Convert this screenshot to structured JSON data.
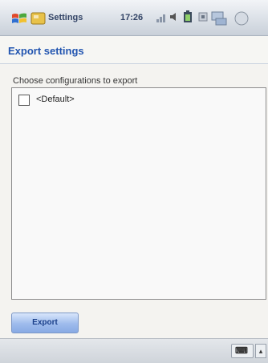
{
  "titlebar": {
    "app_title": "Settings",
    "time": "17:26"
  },
  "page": {
    "heading": "Export settings",
    "section_label": "Choose configurations to export"
  },
  "list": {
    "items": [
      {
        "label": "<Default>",
        "checked": false
      }
    ]
  },
  "actions": {
    "export_label": "Export"
  },
  "bottombar": {
    "keyboard_glyph": "⌨",
    "menu_glyph": "▴"
  },
  "colors": {
    "heading": "#2255b0",
    "button_fill": "#9ebbec",
    "titlebar": "#dfe4ea"
  }
}
